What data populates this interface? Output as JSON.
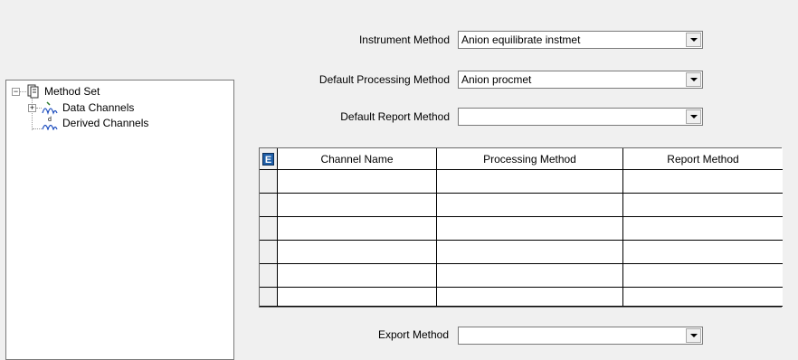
{
  "tree": {
    "root": {
      "label": "Method Set",
      "expander": "−",
      "icon": "method-set-icon"
    },
    "children": [
      {
        "label": "Data Channels",
        "expander": "+",
        "icon": "data-channels-icon"
      },
      {
        "label": "Derived Channels",
        "icon": "derived-channels-icon"
      }
    ]
  },
  "form": {
    "instrument_method": {
      "label": "Instrument Method",
      "value": "Anion equilibrate instmet"
    },
    "default_processing_method": {
      "label": "Default Processing Method",
      "value": "Anion procmet"
    },
    "default_report_method": {
      "label": "Default Report Method",
      "value": ""
    },
    "export_method": {
      "label": "Export Method",
      "value": ""
    }
  },
  "grid": {
    "corner_icon_text": "E",
    "columns": [
      "Channel Name",
      "Processing Method",
      "Report Method"
    ],
    "rows": [
      [
        "",
        "",
        ""
      ],
      [
        "",
        "",
        ""
      ],
      [
        "",
        "",
        ""
      ],
      [
        "",
        "",
        ""
      ],
      [
        "",
        "",
        ""
      ],
      [
        "",
        "",
        ""
      ]
    ]
  }
}
